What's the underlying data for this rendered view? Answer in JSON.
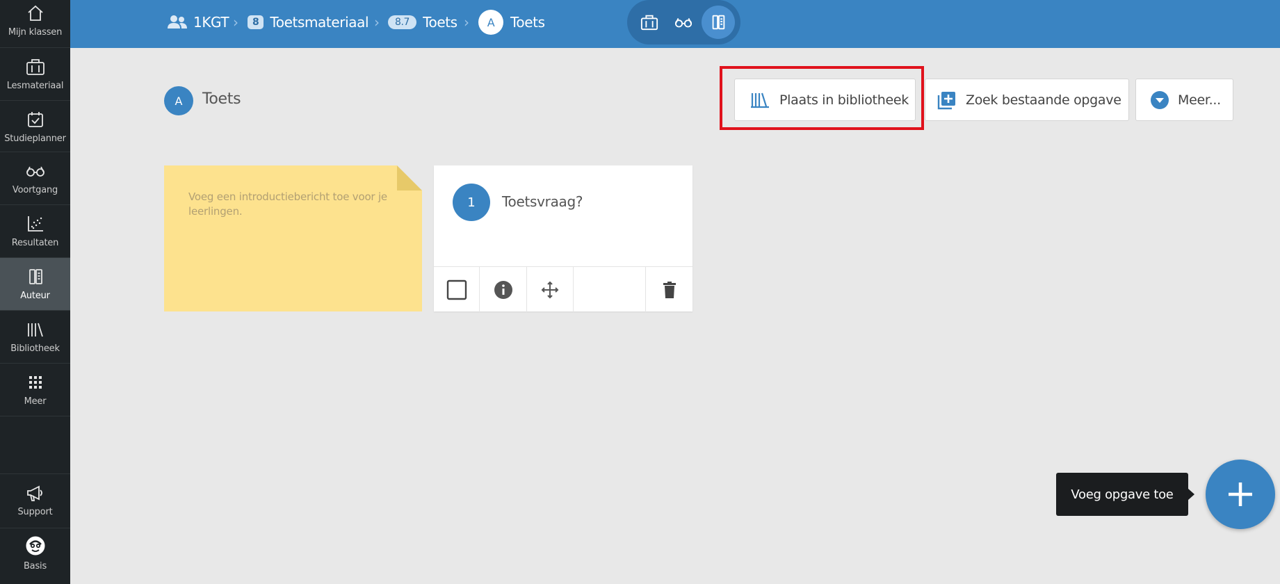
{
  "sidebar": {
    "items": [
      {
        "label": "Mijn klassen",
        "icon": "home-icon"
      },
      {
        "label": "Lesmateriaal",
        "icon": "briefcase-icon"
      },
      {
        "label": "Studieplanner",
        "icon": "calendar-check-icon"
      },
      {
        "label": "Voortgang",
        "icon": "glasses-icon"
      },
      {
        "label": "Resultaten",
        "icon": "scatter-chart-icon"
      },
      {
        "label": "Auteur",
        "icon": "author-icon",
        "active": true
      },
      {
        "label": "Bibliotheek",
        "icon": "library-icon"
      },
      {
        "label": "Meer",
        "icon": "grid-icon"
      }
    ],
    "bottom": [
      {
        "label": "Support",
        "icon": "megaphone-icon"
      },
      {
        "label": "Basis",
        "icon": "avatar-icon"
      }
    ]
  },
  "breadcrumb": {
    "class_name": "1KGT",
    "material_badge": "8",
    "material_label": "Toetsmateriaal",
    "section_badge": "8.7",
    "section_label": "Toets",
    "item_badge": "A",
    "item_label": "Toets"
  },
  "view_switch": [
    "briefcase-icon",
    "glasses-icon",
    "author-icon"
  ],
  "header": {
    "badge": "A",
    "title": "Toets"
  },
  "actions": {
    "place_in_library": "Plaats in bibliotheek",
    "find_existing": "Zoek bestaande opgave",
    "more": "Meer..."
  },
  "intro_note": {
    "placeholder": "Voeg een introductiebericht toe voor je leerlingen."
  },
  "question": {
    "number": "1",
    "text": "Toetsvraag?"
  },
  "fab": {
    "tooltip": "Voeg opgave toe"
  },
  "colors": {
    "primary": "#3a84c2",
    "sidebar": "#1e2326",
    "highlight": "#e0121c",
    "note": "#fde28e"
  }
}
